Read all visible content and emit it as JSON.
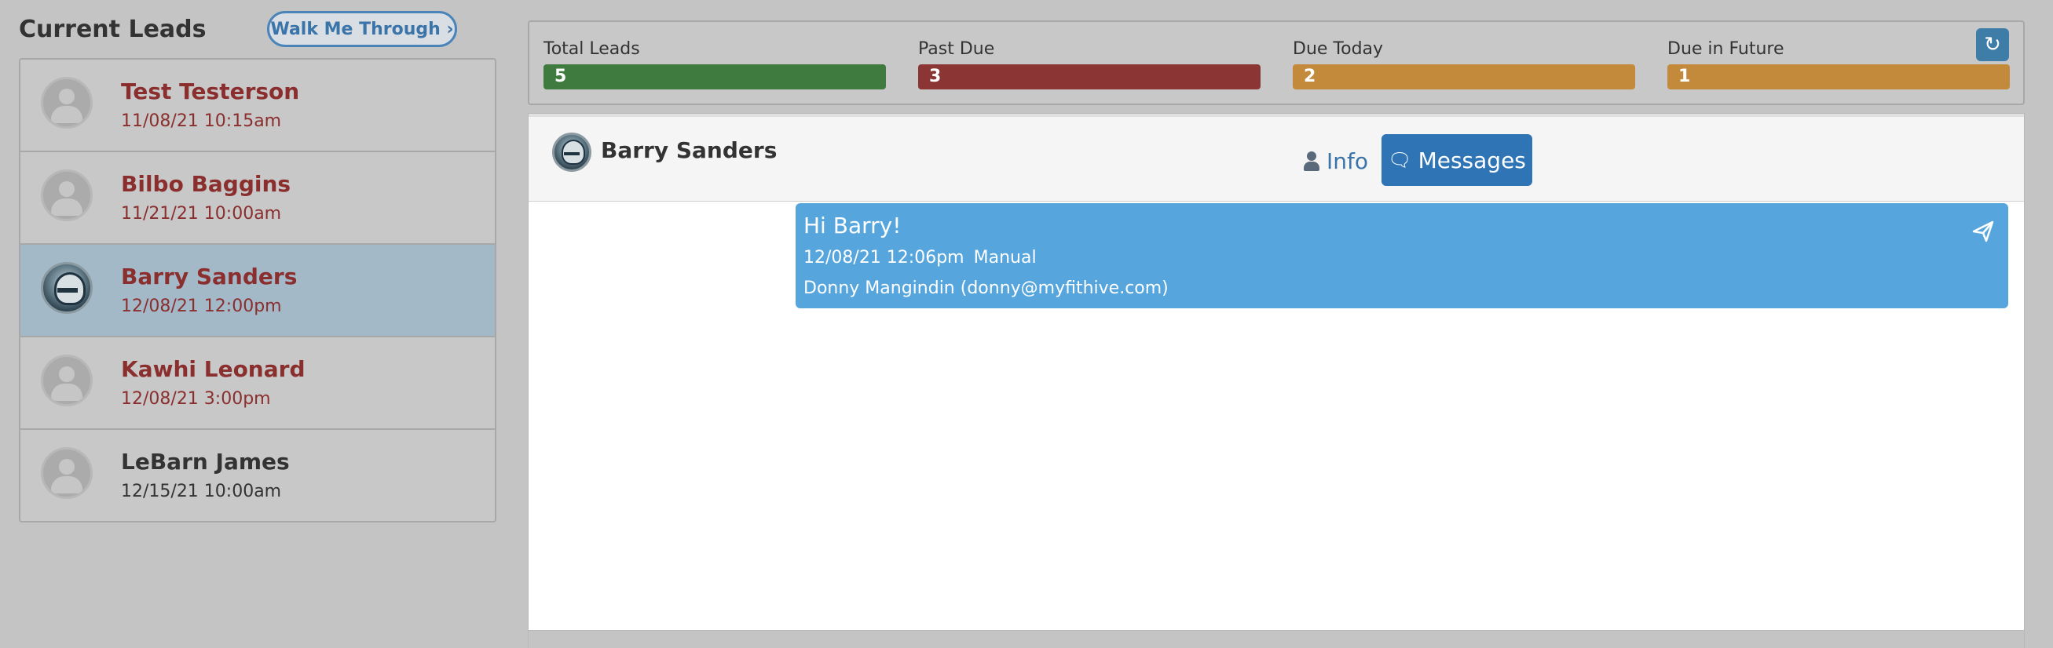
{
  "left": {
    "title": "Current Leads",
    "walk_button": "Walk Me Through ›",
    "leads": [
      {
        "name": "Test Testerson",
        "date": "11/08/21 10:15am"
      },
      {
        "name": "Bilbo Baggins",
        "date": "11/21/21 10:00am"
      },
      {
        "name": "Barry Sanders",
        "date": "12/08/21 12:00pm"
      },
      {
        "name": "Kawhi Leonard",
        "date": "12/08/21 3:00pm"
      },
      {
        "name": "LeBarn James",
        "date": "12/15/21 10:00am"
      }
    ]
  },
  "stats": [
    {
      "label": "Total Leads",
      "value": "5",
      "color": "#3f7a3f"
    },
    {
      "label": "Past Due",
      "value": "3",
      "color": "#8c3535"
    },
    {
      "label": "Due Today",
      "value": "2",
      "color": "#c38a3c"
    },
    {
      "label": "Due in Future",
      "value": "1",
      "color": "#c38a3c"
    }
  ],
  "conversation": {
    "name": "Barry Sanders",
    "tab_info": "Info",
    "tab_messages": "Messages",
    "message": {
      "text": "Hi Barry!",
      "time": "12/08/21 12:06pm",
      "type": "Manual",
      "author": "Donny Mangindin (donny@myfithive.com)"
    }
  },
  "colors": {
    "accent": "#2f74b5",
    "message_bg": "#56a6dd",
    "lead_name": "#8b2e2e"
  }
}
